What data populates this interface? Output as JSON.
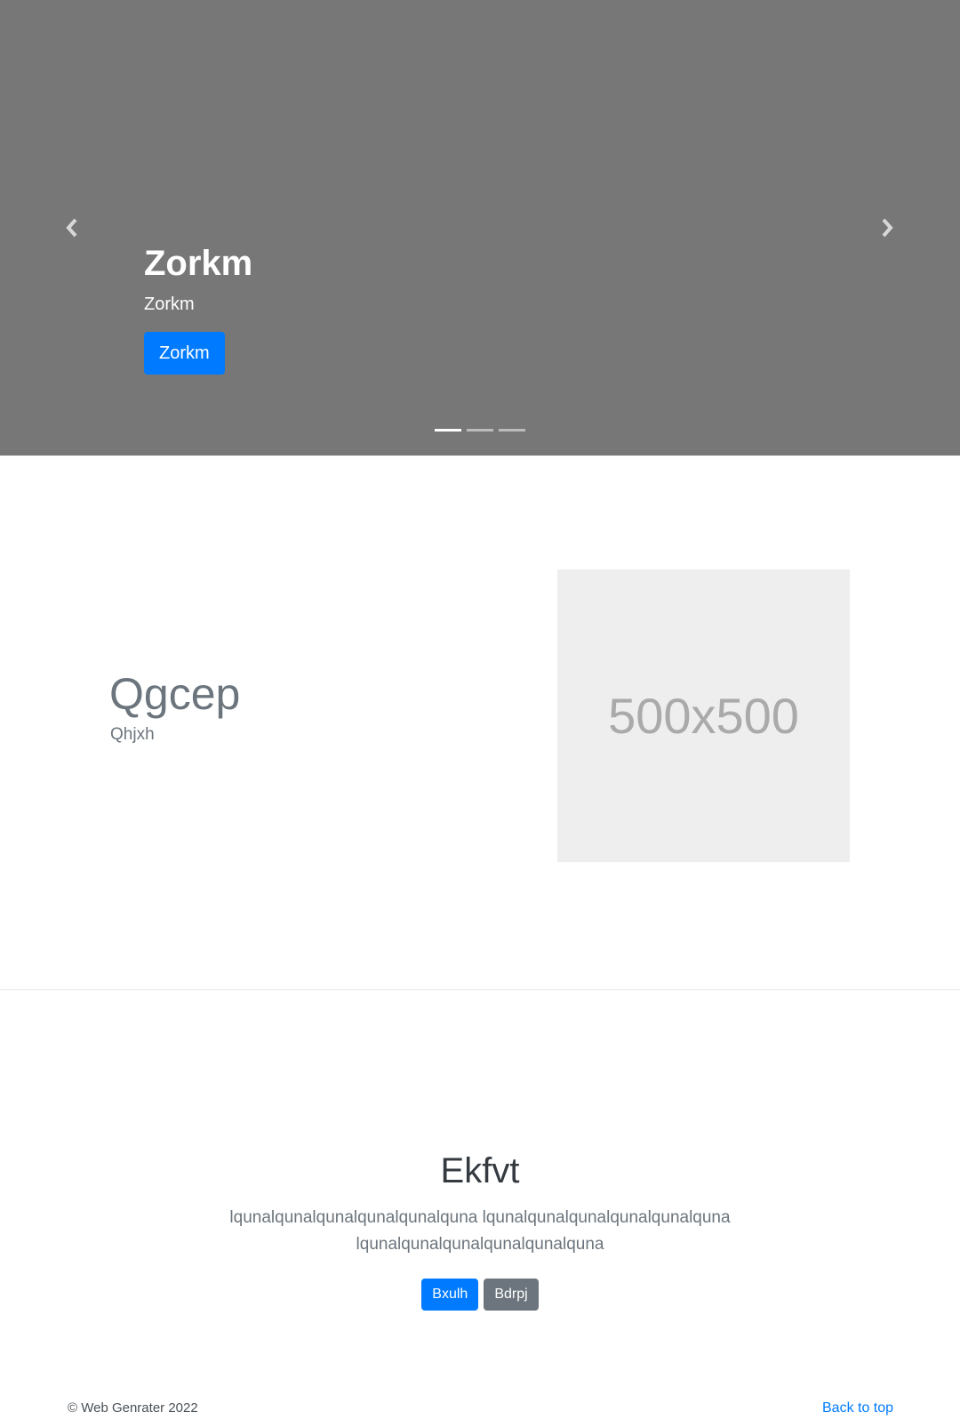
{
  "carousel": {
    "slide_title": "Zorkm",
    "slide_subtitle": "Zorkm",
    "slide_button": "Zorkm",
    "indicators": 3,
    "active_indicator": 1,
    "background_color": "#777777"
  },
  "feature": {
    "title": "Qgcep",
    "subtitle": "Qhjxh",
    "image_placeholder": "500x500"
  },
  "jumbotron": {
    "title": "Ekfvt",
    "text": "lqunalqunalqunalqunalqunalquna lqunalqunalqunalqunalqunalquna lqunalqunalqunalqunalqunalquna",
    "primary_button": "Bxulh",
    "secondary_button": "Bdrpj"
  },
  "footer": {
    "copyright": "© Web Genrater 2022",
    "back_to_top": "Back to top"
  },
  "colors": {
    "primary": "#007bff",
    "secondary": "#6c757d"
  }
}
